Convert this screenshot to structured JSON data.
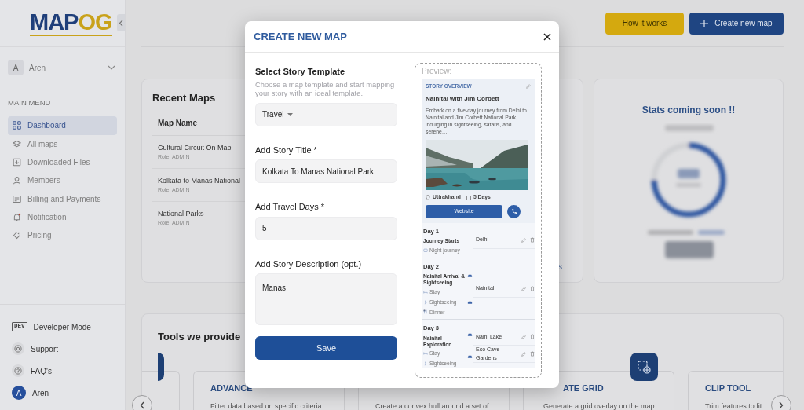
{
  "sidebar": {
    "logo": {
      "primary": "MAP",
      "accent": "OG"
    },
    "user": {
      "initial": "A",
      "name": "Aren"
    },
    "menu_heading": "MAIN MENU",
    "menu": [
      {
        "label": "Dashboard",
        "selected": true
      },
      {
        "label": "All maps",
        "selected": false
      },
      {
        "label": "Downloaded Files",
        "selected": false
      },
      {
        "label": "Members",
        "selected": false
      },
      {
        "label": "Billing and Payments",
        "selected": false
      },
      {
        "label": "Notification",
        "selected": false
      },
      {
        "label": "Pricing",
        "selected": false
      }
    ],
    "footer": [
      {
        "label": "Developer Mode",
        "badge": "DEV"
      },
      {
        "label": "Support"
      },
      {
        "label": "FAQ's"
      }
    ],
    "account": {
      "initial": "A",
      "name": "Aren"
    }
  },
  "header": {
    "buttons": [
      {
        "label": "How it works",
        "kind": "secondary"
      },
      {
        "label": "Create new map",
        "kind": "primary"
      }
    ]
  },
  "recent_maps": {
    "title": "Recent Maps",
    "column": "Map Name",
    "rows": [
      {
        "name": "Cultural Circuit On Map",
        "role": "Role: ADMIN"
      },
      {
        "name": "Kolkata to Manas National",
        "role": "Role: ADMIN"
      },
      {
        "name": "National Parks",
        "role": "Role: ADMIN"
      }
    ]
  },
  "middle_card": {
    "link": "s"
  },
  "stats": {
    "title": "Stats coming soon !!"
  },
  "tools": {
    "title": "Tools we provide",
    "cards": [
      {
        "title": "ADVANCE",
        "description": "Filter data based on specific criteria"
      },
      {
        "description": "Create a convex hull around a set of"
      },
      {
        "title": "ATE GRID",
        "description": "Generate a grid overlay on the map"
      },
      {
        "title": "CLIP TOOL",
        "description": "Trim features to fit"
      }
    ]
  },
  "modal": {
    "title": "CREATE NEW MAP",
    "form": {
      "template_label": "Select Story Template",
      "template_hint": "Choose a map template and start mapping your story with an ideal template.",
      "template_value": "Travel",
      "title_label": "Add Story Title *",
      "title_value": "Kolkata To Manas National Park",
      "days_label": "Add Travel Days *",
      "days_value": "5",
      "description_label": "Add Story Description (opt.)",
      "description_value": "Manas",
      "save": "Save"
    },
    "preview": {
      "label": "Preview:",
      "overview": {
        "heading": "STORY OVERVIEW",
        "title": "Nainital with Jim Corbett",
        "description": "Embark on a five-day journey from Delhi to Nainital and Jim Corbett National Park, indulging in sightseeing, safaris, and serene…",
        "location": "Uttrakhand",
        "duration": "5 Days",
        "button": "Website"
      },
      "days": [
        {
          "title": "Day 1",
          "subtitle": "Journey Starts",
          "activities": [
            {
              "label": "Night journey",
              "kind": "transport"
            }
          ],
          "stops": [
            "Delhi"
          ]
        },
        {
          "title": "Day 2",
          "subtitle": "Nainital Arrival & Sightseeing",
          "activities": [
            {
              "label": "Stay",
              "kind": "stay"
            },
            {
              "label": "Sightseeing",
              "kind": "sightseeing"
            },
            {
              "label": "Dinner",
              "kind": "dinner"
            }
          ],
          "stops": [
            "Nainital"
          ]
        },
        {
          "title": "Day 3",
          "subtitle": "Nainital Exploration",
          "activities": [
            {
              "label": "Stay",
              "kind": "stay"
            },
            {
              "label": "Sightseeing",
              "kind": "sightseeing"
            }
          ],
          "stops": [
            "Naini Lake",
            "Eco Cave Gardens"
          ]
        }
      ]
    }
  }
}
